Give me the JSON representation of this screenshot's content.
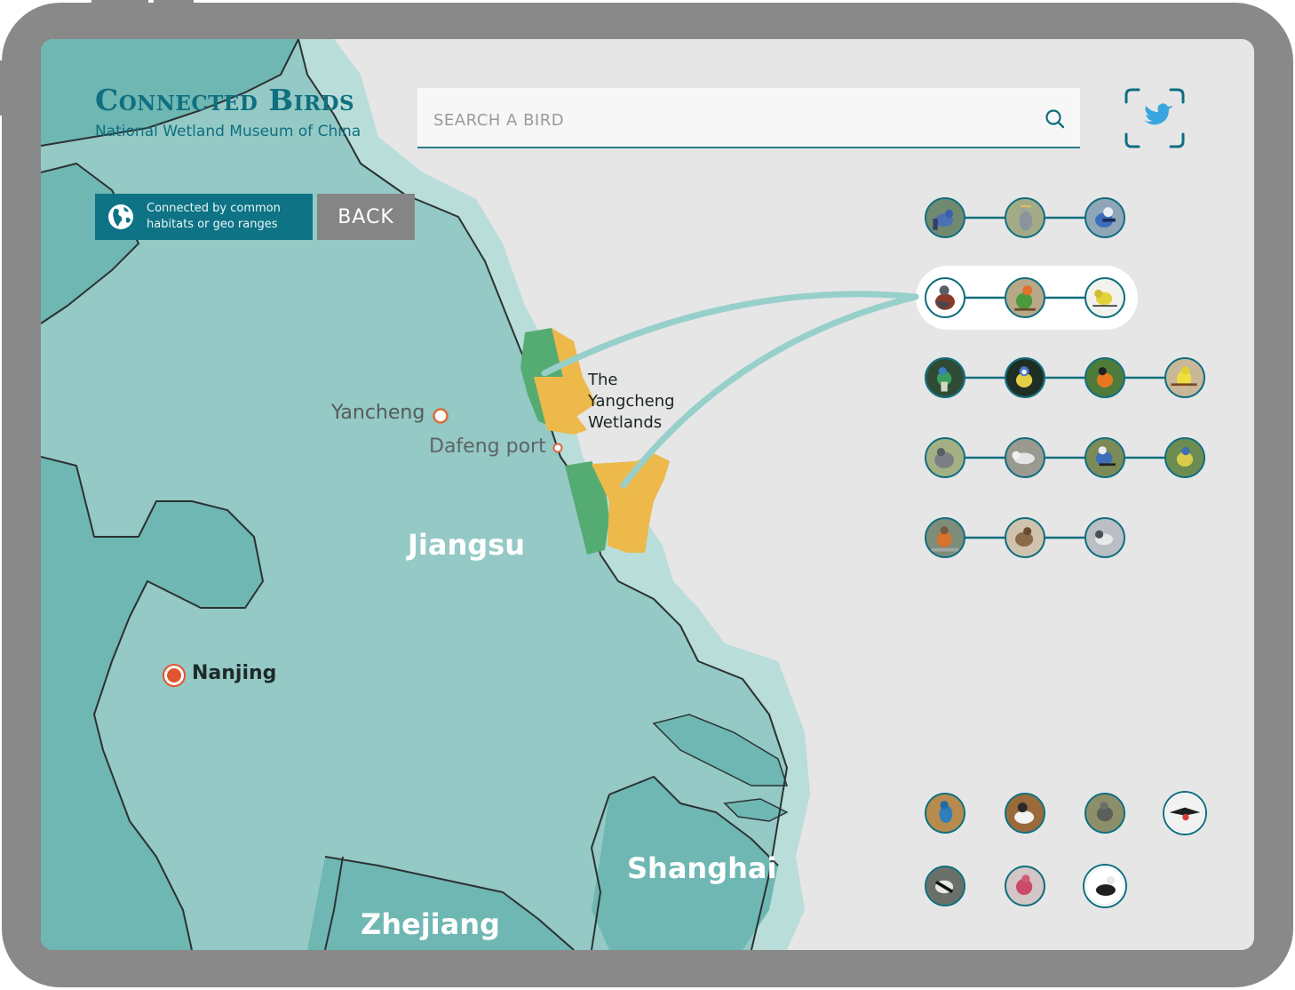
{
  "header": {
    "title": "Connected Birds",
    "subtitle": "National Wetland Museum of China"
  },
  "search": {
    "placeholder": "SEARCH A BIRD",
    "value": ""
  },
  "connection_filter": {
    "label": "Connected by common habitats or geo ranges",
    "icon": "globe-icon"
  },
  "back_button": {
    "label": "BACK"
  },
  "map": {
    "labels": {
      "yancheng": "Yancheng",
      "dafeng": "Dafeng port",
      "jiangsu": "Jiangsu",
      "nanjing": "Nanjing",
      "shanghai": "Shanghai",
      "zhejiang": "Zhejiang",
      "wetlands": "The Yangcheng Wetlands"
    },
    "colors": {
      "land_light": "#94c9c5",
      "land_dark": "#6fb7b3",
      "coast_halo": "#b9ddd9",
      "wetland_yellow": "#ecb94a",
      "wetland_green": "#55ac72",
      "connection_line": "#97cfcb",
      "city_marker": "#e0552e"
    }
  },
  "bird_groups": [
    {
      "id": "row-1",
      "connected": false,
      "birds": [
        "fairy-wren",
        "grey-heron",
        "blue-jay"
      ]
    },
    {
      "id": "row-2",
      "connected": true,
      "highlighted": true,
      "birds": [
        "pigeon",
        "lovebird",
        "yellow-warbler"
      ]
    },
    {
      "id": "row-3",
      "connected": false,
      "birds": [
        "sunbird",
        "blue-tit",
        "oriole",
        "prairie-warbler"
      ]
    },
    {
      "id": "row-4",
      "connected": false,
      "birds": [
        "quail",
        "gull",
        "magpie-jay",
        "great-tit"
      ]
    },
    {
      "id": "row-5",
      "connected": false,
      "birds": [
        "robin",
        "sparrow",
        "junco"
      ]
    }
  ],
  "other_birds": [
    [
      "kingfisher",
      "duck",
      "starling",
      "frigatebird"
    ],
    [
      "black-white-warbler",
      "pink-finch",
      "eider"
    ]
  ]
}
